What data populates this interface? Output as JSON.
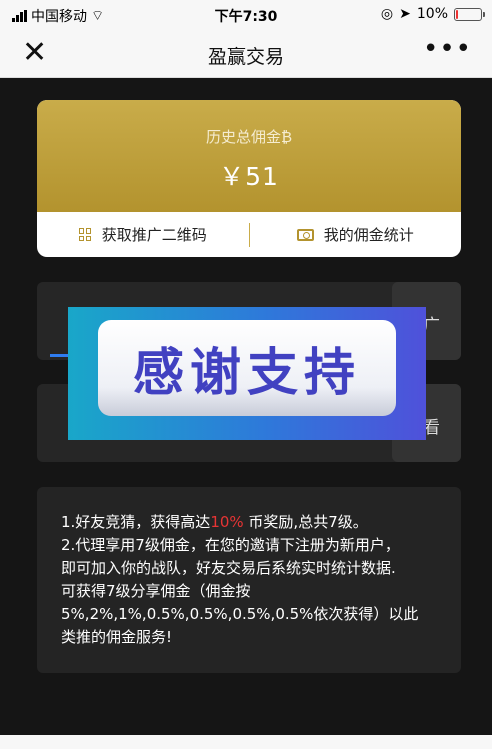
{
  "status_bar": {
    "carrier": "中国移动",
    "time": "下午7:30",
    "battery": "10%",
    "battery_level": 0.1
  },
  "nav": {
    "title": "盈赢交易",
    "close_label": "✕",
    "more_label": "•••"
  },
  "commission": {
    "label": "历史总佣金",
    "coin_symbol": "₿",
    "amount": "￥51",
    "actions": [
      {
        "label": "获取推广二维码"
      },
      {
        "label": "我的佣金统计"
      }
    ]
  },
  "panels": {
    "first_side_text": "广",
    "second_side_text": "看"
  },
  "overlay": {
    "text": "感谢支持"
  },
  "rules": {
    "line1_prefix": "1.好友竞猜，获得高达",
    "line1_highlight": "10%",
    "line1_suffix": " 币奖励,总共7级。",
    "line2": "2.代理享用7级佣金，在您的邀请下注册为新用户，",
    "line3": "即可加入你的战队，好友交易后系统实时统计数据.",
    "line4": "可获得7级分享佣金（佣金按",
    "line5": "5%,2%,1%,0.5%,0.5%,0.5%,0.5%依次获得）以此",
    "line6": "类推的佣金服务!"
  },
  "colors": {
    "accent_gold": "#b3932e",
    "accent_blue": "#2f7df0",
    "highlight_red": "#e63434"
  }
}
